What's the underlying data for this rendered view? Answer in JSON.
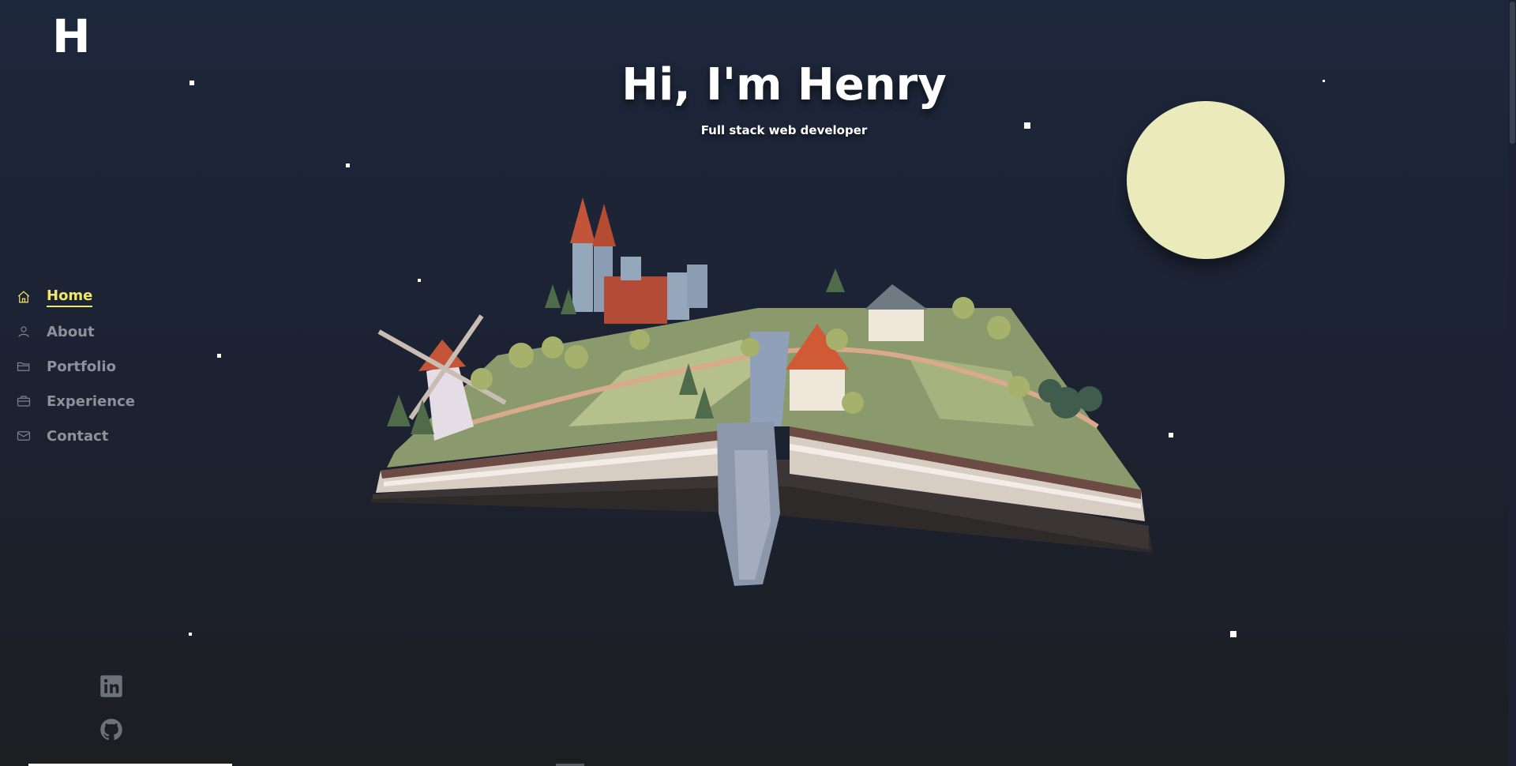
{
  "logo": {
    "text": "H"
  },
  "hero": {
    "title": "Hi, I'm Henry",
    "subtitle": "Full stack web developer"
  },
  "nav": {
    "items": [
      {
        "label": "Home",
        "icon": "home-icon",
        "active": true
      },
      {
        "label": "About",
        "icon": "user-icon",
        "active": false
      },
      {
        "label": "Portfolio",
        "icon": "folder-icon",
        "active": false
      },
      {
        "label": "Experience",
        "icon": "briefcase-icon",
        "active": false
      },
      {
        "label": "Contact",
        "icon": "mail-icon",
        "active": false
      }
    ]
  },
  "social": [
    {
      "name": "linkedin-icon"
    },
    {
      "name": "github-icon"
    }
  ],
  "colors": {
    "accent": "#f1e66c",
    "nav_inactive": "#8d9199",
    "moon": "#ebeabb",
    "background_top": "#1d273b",
    "background_bottom": "#1d1e22"
  }
}
